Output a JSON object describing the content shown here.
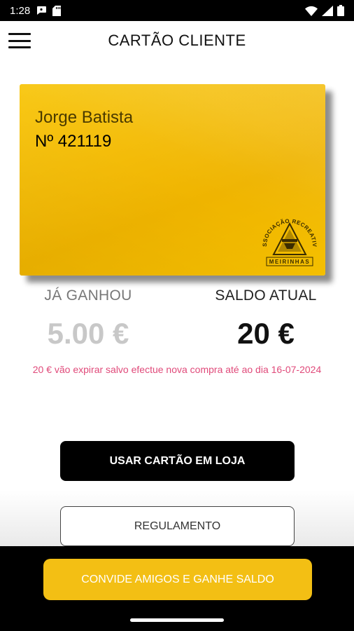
{
  "status_bar": {
    "time": "1:28",
    "icons": [
      "chat-bubble-icon",
      "sd-card-icon",
      "wifi-icon",
      "signal-icon",
      "battery-icon"
    ]
  },
  "header": {
    "title": "CARTÃO CLIENTE",
    "menu_icon": "hamburger-menu-icon"
  },
  "card": {
    "holder_name": "Jorge Batista",
    "number": "Nº 421119",
    "logo": "associacao-recreativa-meirinhas-logo",
    "logo_text_top": "ASSOCIAÇÃO RECREATIVA",
    "logo_text_bottom": "MEIRINHAS",
    "color": "#f2b906"
  },
  "balances": {
    "earned_label": "JÁ GANHOU",
    "earned_value": "5.00 €",
    "current_label": "SALDO ATUAL",
    "current_value": "20 €"
  },
  "expire_note": "20 € vão expirar salvo efectue nova compra até ao dia 16-07-2024",
  "buttons": {
    "use_card": "USAR CARTÃO EM LOJA",
    "rules": "REGULAMENTO",
    "invite": "CONVIDE AMIGOS E GANHE SALDO"
  },
  "colors": {
    "accent": "#f3bf14",
    "warning_text": "#e04a7a",
    "primary_button": "#000000"
  }
}
